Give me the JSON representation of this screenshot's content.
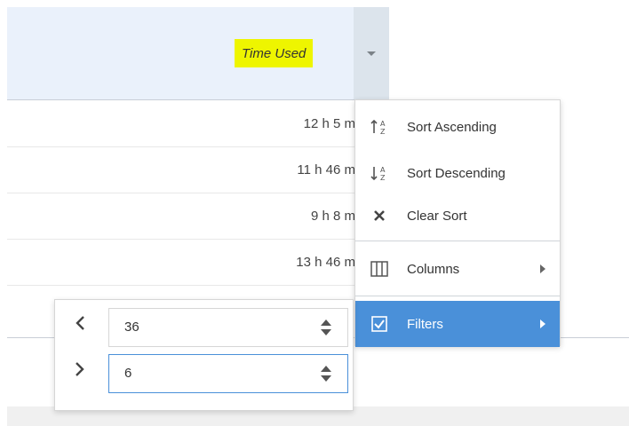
{
  "column": {
    "title": "Time Used"
  },
  "rows": [
    {
      "time_used": "12 h 5 m"
    },
    {
      "time_used": "11 h 46 m"
    },
    {
      "time_used": "9 h 8 m"
    },
    {
      "time_used": "13 h 46 m"
    }
  ],
  "menu": {
    "sort_ascending": "Sort Ascending",
    "sort_descending": "Sort Descending",
    "clear_sort": "Clear Sort",
    "columns": "Columns",
    "filters": "Filters"
  },
  "filter": {
    "greater_than_symbol": "<",
    "less_than_symbol": ">",
    "first_value": "36",
    "second_value": "6"
  },
  "colors": {
    "highlight": "#eef500",
    "header_bg": "#eaf1fb",
    "menu_active": "#4a90d9"
  },
  "icons": {
    "header_trigger": "chevron-down-icon",
    "sort_ascending": "sort-ascending-icon",
    "sort_descending": "sort-descending-icon",
    "clear_sort": "close-icon",
    "columns": "columns-icon",
    "filters": "checkbox-checked-icon"
  }
}
